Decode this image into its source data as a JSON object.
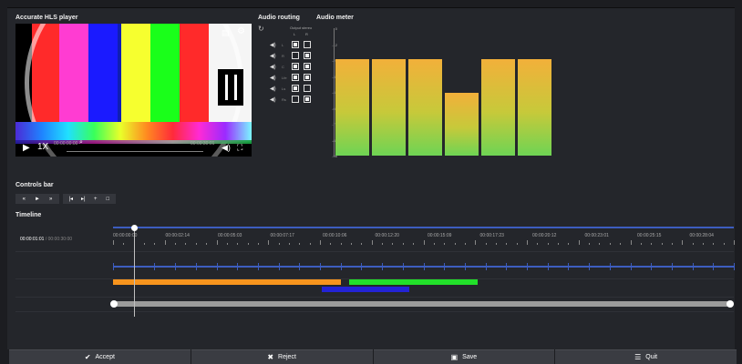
{
  "panels": {
    "player_title": "Accurate HLS player",
    "routing_title": "Audio routing",
    "meter_title": "Audio meter",
    "controls_title": "Controls bar",
    "timeline_title": "Timeline"
  },
  "player": {
    "speed": "1X",
    "current_time": "00:00:00:00",
    "duration": "00:00:30:01",
    "colors": [
      "#000000",
      "#ff2a2a",
      "#ff3cd2",
      "#1a1aff",
      "#0f1eb4",
      "#f6ff2f",
      "#1aff1a",
      "#ff2a2a",
      "#f5f5f5"
    ]
  },
  "routing": {
    "subtitle": "Output stereo",
    "left": "L",
    "right": "R",
    "rows": [
      {
        "ch": "L",
        "l": true,
        "r": false
      },
      {
        "ch": "R",
        "l": false,
        "r": true
      },
      {
        "ch": "C",
        "l": true,
        "r": true
      },
      {
        "ch": "Lfe",
        "l": true,
        "r": true
      },
      {
        "ch": "Ls",
        "l": true,
        "r": false
      },
      {
        "ch": "Rs",
        "l": false,
        "r": true
      }
    ]
  },
  "meter": {
    "scale": [
      "0",
      "-12",
      "-24",
      "-36",
      "-48",
      "-60",
      "-72",
      "-84",
      "-96"
    ],
    "levels_db": [
      -23,
      -23,
      -23,
      -49,
      -23,
      -23
    ]
  },
  "controls": {
    "group1": [
      "«",
      "►",
      "»"
    ],
    "group2": [
      "|◂",
      "▸|",
      "+",
      "□"
    ]
  },
  "timeline": {
    "current": "00:00:01:01",
    "total": "00:00:30:00",
    "labels": [
      "00:00:00:00",
      "00:00:02:14",
      "00:00:05:03",
      "00:00:07:17",
      "00:00:10:06",
      "00:00:12:20",
      "00:00:15:09",
      "00:00:17:23",
      "00:00:20:12",
      "00:00:23:01",
      "00:00:25:15",
      "00:00:28:04"
    ],
    "segments": [
      {
        "color": "#f7941d",
        "start_s": 0.0,
        "end_s": 11.0
      },
      {
        "color": "#22e02a",
        "start_s": 11.4,
        "end_s": 17.6
      },
      {
        "color": "#2323d6",
        "start_s": 10.1,
        "end_s": 14.3
      }
    ]
  },
  "actions": {
    "accept": "Accept",
    "reject": "Reject",
    "save": "Save",
    "quit": "Quit"
  }
}
